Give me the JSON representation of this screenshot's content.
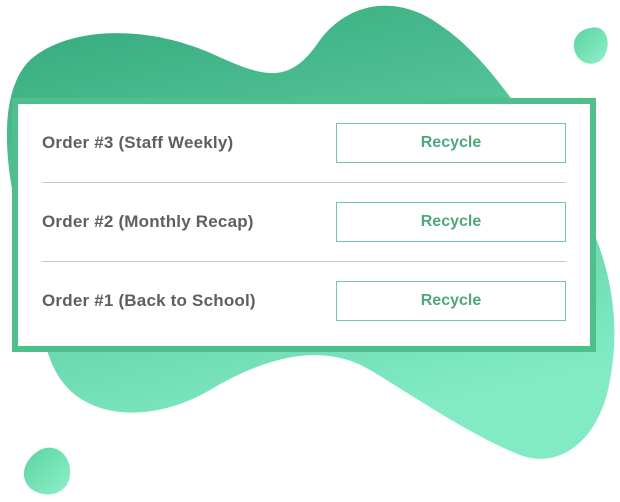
{
  "colors": {
    "card_border": "#4fbf8c",
    "blob_top": "#38ad80",
    "blob_bottom": "#7fe6bf",
    "button_text": "#4fa77f",
    "label_text": "#5f5f5f"
  },
  "orders": [
    {
      "label": "Order #3 (Staff Weekly)",
      "button_label": "Recycle"
    },
    {
      "label": "Order #2 (Monthly Recap)",
      "button_label": "Recycle"
    },
    {
      "label": "Order #1 (Back to School)",
      "button_label": "Recycle"
    }
  ]
}
